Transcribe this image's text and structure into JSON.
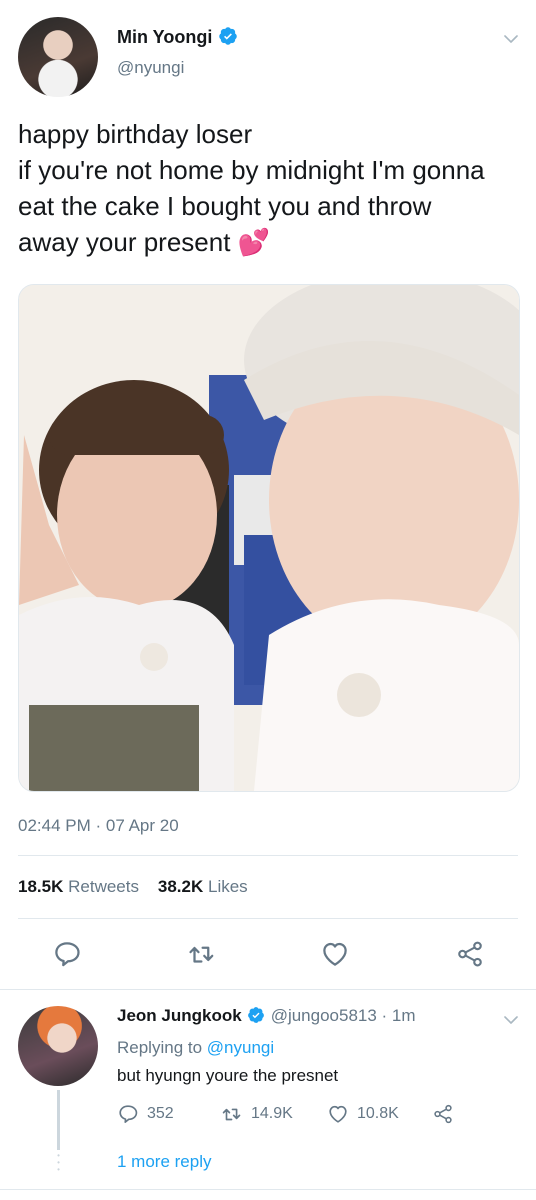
{
  "tweet": {
    "author_name": "Min Yoongi",
    "author_handle": "@nyungi",
    "text_lines": [
      "happy birthday loser",
      "if you're not home by midnight I'm gonna",
      "eat the cake I bought you and throw",
      "away your present 💕"
    ],
    "timestamp": "02:44 PM · 07 Apr 20",
    "retweets_count": "18.5K",
    "retweets_label": "Retweets",
    "likes_count": "38.2K",
    "likes_label": "Likes",
    "actions": [
      "reply-icon",
      "retweet-icon",
      "like-icon",
      "share-icon"
    ]
  },
  "reply": {
    "author_name": "Jeon Jungkook",
    "author_handle": "@jungoo5813 · 1m",
    "replying_prefix": "Replying to",
    "replying_mention": "@nyungi",
    "text": "but hyungn youre the presnet",
    "reply_count": "352",
    "retweet_count": "14.9K",
    "like_count": "10.8K",
    "more_replies": "1 more reply"
  },
  "colors": {
    "accent": "#1da1f2",
    "secondary_text": "#657786",
    "divider": "#e1e8ed"
  }
}
